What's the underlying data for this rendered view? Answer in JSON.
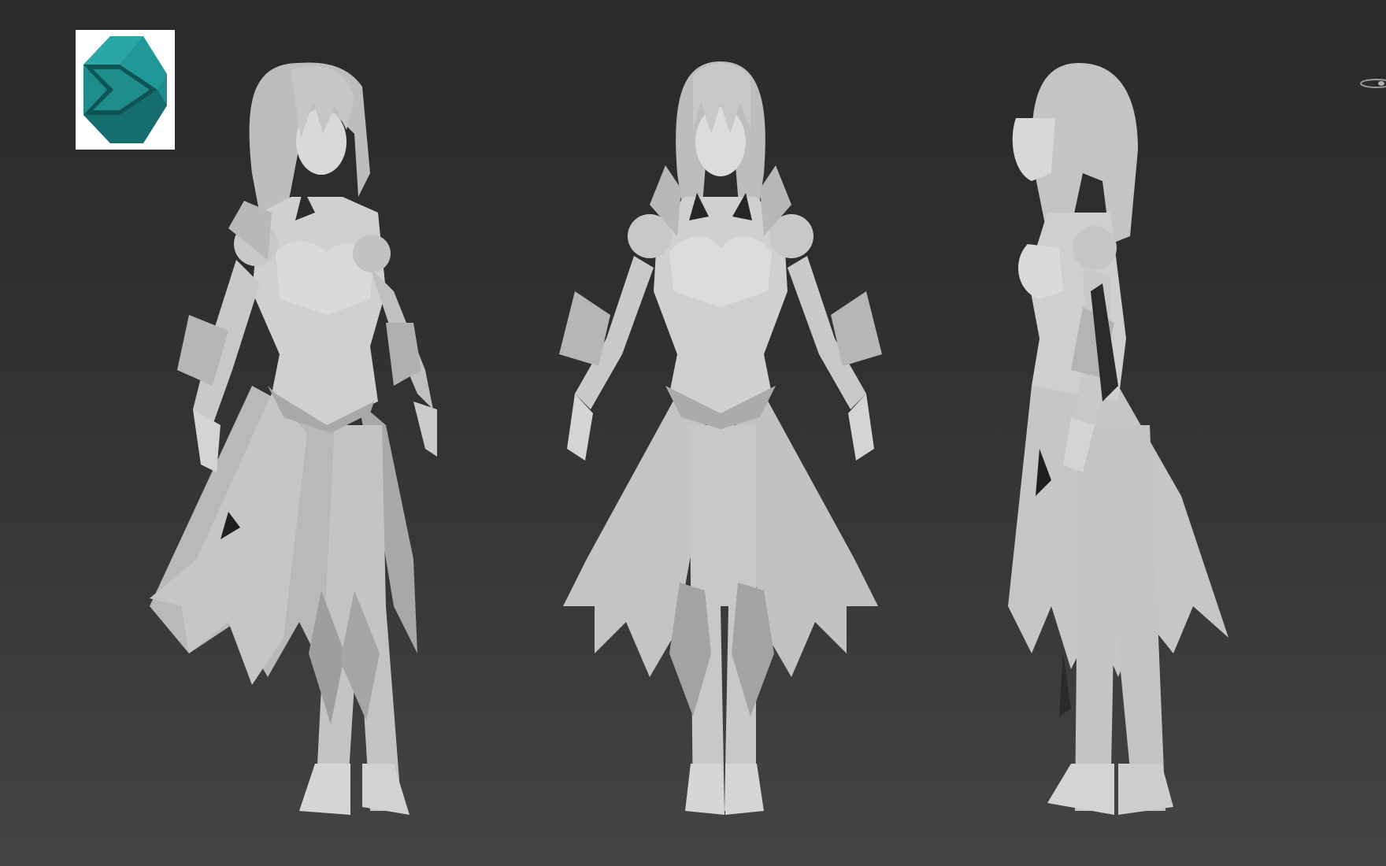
{
  "app": {
    "logo_icon": "3ds-max-logo-icon",
    "logo_color": "#1f8c8c"
  },
  "viewport": {
    "background_top": "#2a2a2a",
    "background_bottom": "#444444",
    "model_color": "#cfcfcf",
    "views": [
      "three-quarter-view",
      "front-view",
      "side-view"
    ]
  }
}
